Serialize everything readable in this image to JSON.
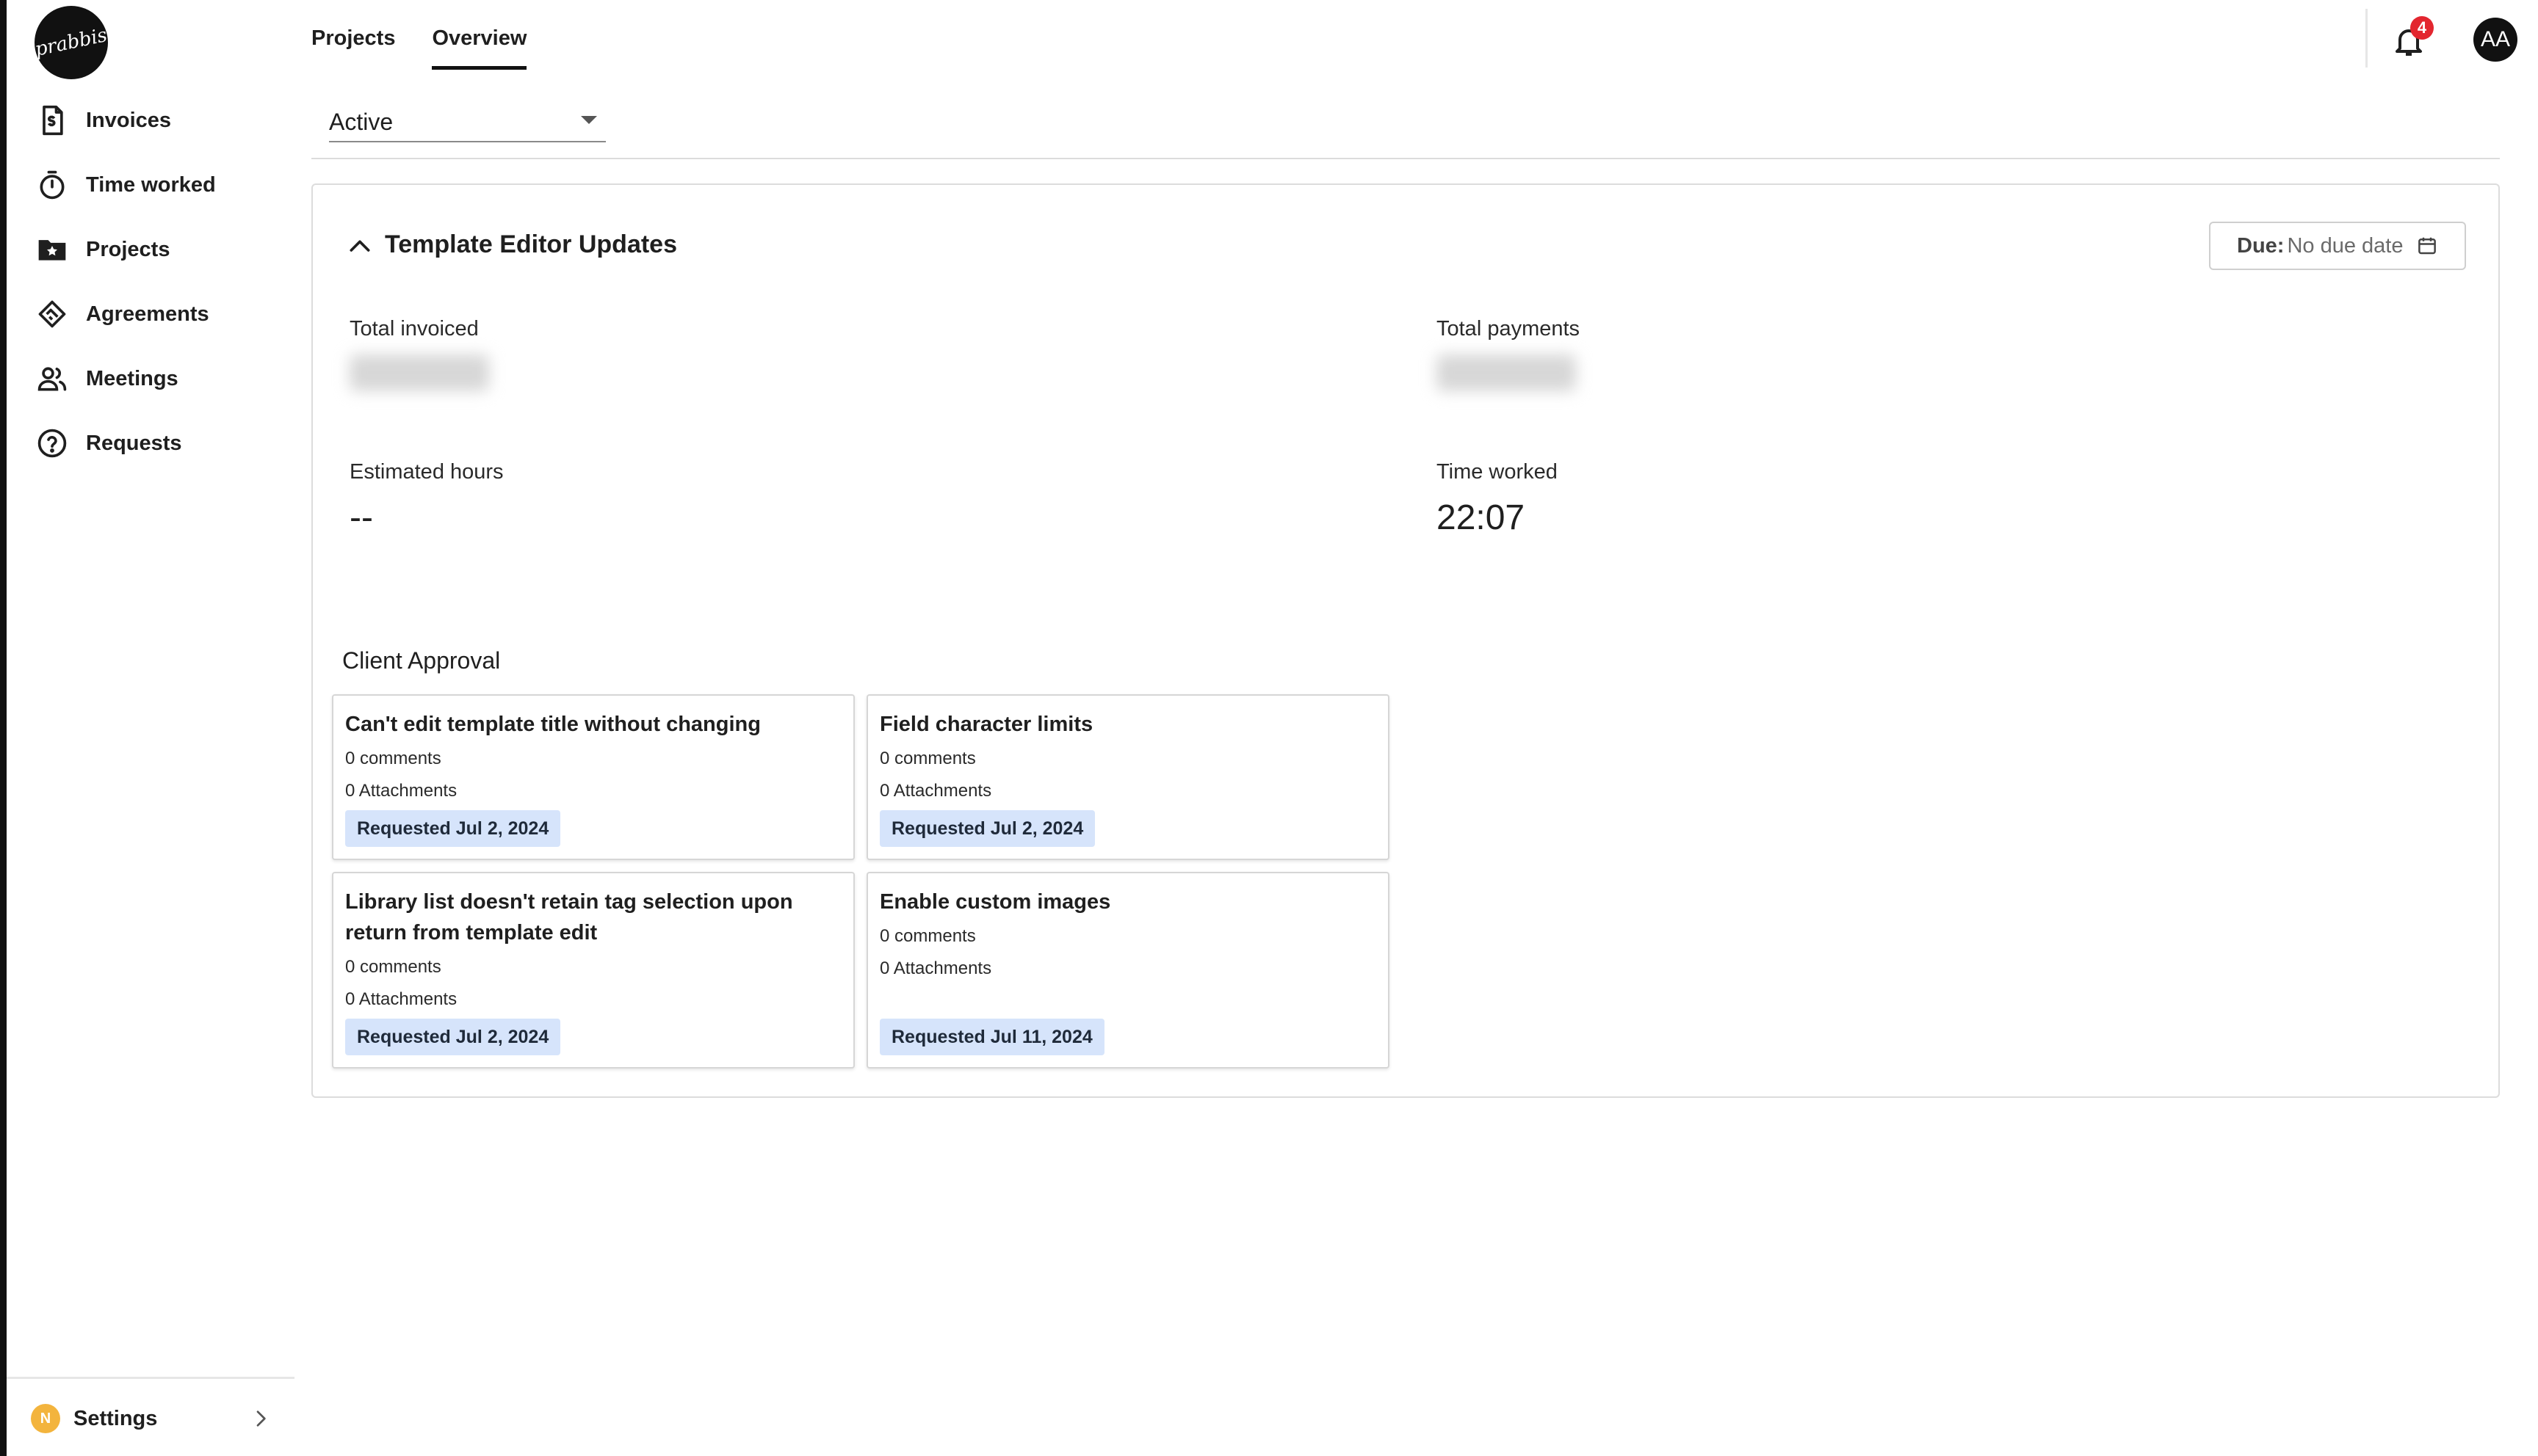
{
  "app": {
    "logo_text": "prabbis"
  },
  "sidebar": {
    "items": [
      {
        "label": "Invoices",
        "icon": "invoice-icon"
      },
      {
        "label": "Time worked",
        "icon": "timer-icon"
      },
      {
        "label": "Projects",
        "icon": "folder-star-icon"
      },
      {
        "label": "Agreements",
        "icon": "handshake-icon"
      },
      {
        "label": "Meetings",
        "icon": "people-icon"
      },
      {
        "label": "Requests",
        "icon": "help-circle-icon"
      }
    ],
    "settings": {
      "badge": "N",
      "label": "Settings"
    }
  },
  "tabs": [
    {
      "label": "Projects",
      "active": false
    },
    {
      "label": "Overview",
      "active": true
    }
  ],
  "header": {
    "notification_count": "4",
    "avatar_initials": "AA"
  },
  "filter": {
    "status_value": "Active"
  },
  "project": {
    "title": "Template Editor Updates",
    "due_label": "Due:",
    "due_value": "No due date",
    "stats": {
      "total_invoiced_label": "Total invoiced",
      "total_payments_label": "Total payments",
      "estimated_hours_label": "Estimated hours",
      "estimated_hours_value": "--",
      "time_worked_label": "Time worked",
      "time_worked_value": "22:07"
    },
    "approval_title": "Client Approval",
    "approvals": [
      {
        "title": "Can't edit template title without changing",
        "comments": "0 comments",
        "attachments": "0 Attachments",
        "requested": "Requested Jul 2, 2024"
      },
      {
        "title": "Field character limits",
        "comments": "0 comments",
        "attachments": "0 Attachments",
        "requested": "Requested Jul 2, 2024"
      },
      {
        "title": "Library list doesn't retain tag selection upon return from template edit",
        "comments": "0 comments",
        "attachments": "0 Attachments",
        "requested": "Requested Jul 2, 2024"
      },
      {
        "title": "Enable custom images",
        "comments": "0 comments",
        "attachments": "0 Attachments",
        "requested": "Requested Jul 11, 2024"
      }
    ]
  },
  "colors": {
    "accent": "#111111",
    "badge_bg": "#d6e4fb",
    "notification": "#e3262f",
    "settings_badge": "#f3b43d"
  }
}
